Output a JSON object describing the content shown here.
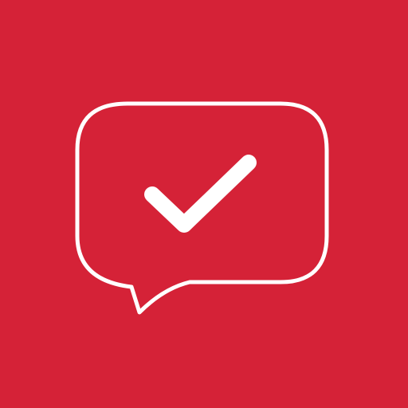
{
  "icon": {
    "name": "chat-bubble-check-icon",
    "background_color": "#D52237",
    "foreground_color": "#FFFFFF"
  }
}
